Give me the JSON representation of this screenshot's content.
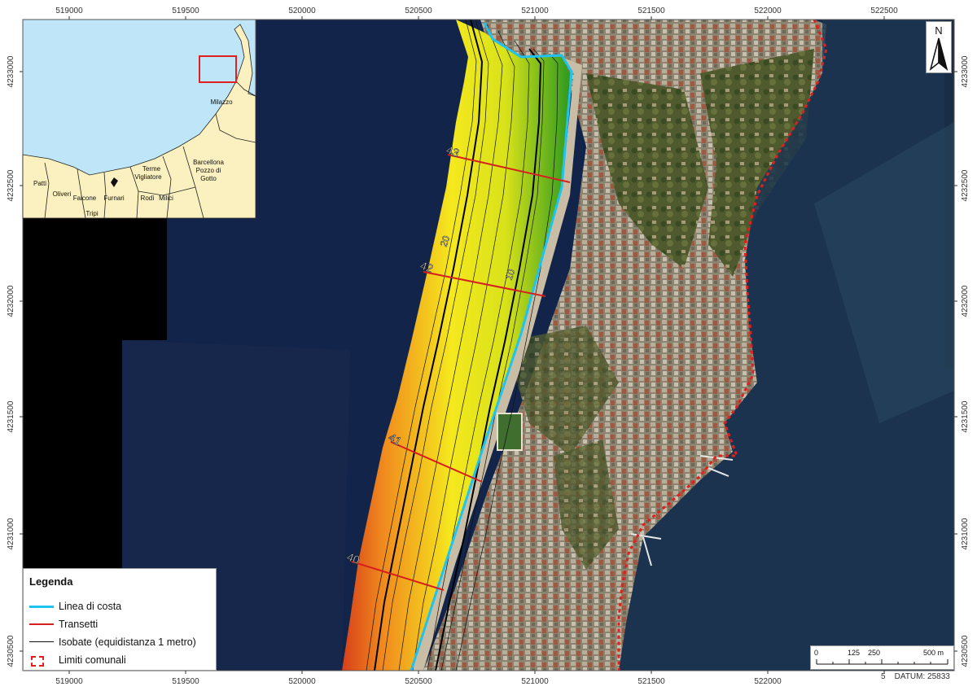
{
  "map": {
    "x_ticks": [
      "519000",
      "519500",
      "520000",
      "520500",
      "521000",
      "521500",
      "522000",
      "522500"
    ],
    "y_ticks": [
      "4233000",
      "4232500",
      "4232000",
      "4231500",
      "4231000",
      "4230500"
    ],
    "contour_labels": [
      "20",
      "10"
    ],
    "transect_labels": [
      "43",
      "42",
      "41",
      "40"
    ],
    "colors": {
      "sea": "#13244a",
      "shoreline": "#1ec3f0",
      "transect": "#d62020",
      "isobath": "#111111",
      "boundary": "#e02020",
      "deep": "#e8551a",
      "mid": "#f2e21a",
      "shallow": "#2d9a1c"
    }
  },
  "inset": {
    "places": [
      "Milazzo",
      "Barcellona Pozzo di Gotto",
      "Terme Vigliatore",
      "Patti",
      "Oliveri",
      "Falcone",
      "Furnari",
      "Rodì",
      "Milici",
      "Tripi"
    ]
  },
  "legend": {
    "title": "Legenda",
    "items": [
      {
        "label": "Linea di costa",
        "symbol": "shoreline-line"
      },
      {
        "label": "Transetti",
        "symbol": "transect-line"
      },
      {
        "label": "Isobate (equidistanza 1 metro)",
        "symbol": "isobath-line"
      },
      {
        "label": "Limiti comunali",
        "symbol": "boundary-dashed"
      }
    ]
  },
  "north_arrow": {
    "label": "N"
  },
  "scale_bar": {
    "labels": [
      "0",
      "125",
      "250",
      "500 m"
    ]
  },
  "datum": {
    "text": "5    DATUM: 25833"
  }
}
